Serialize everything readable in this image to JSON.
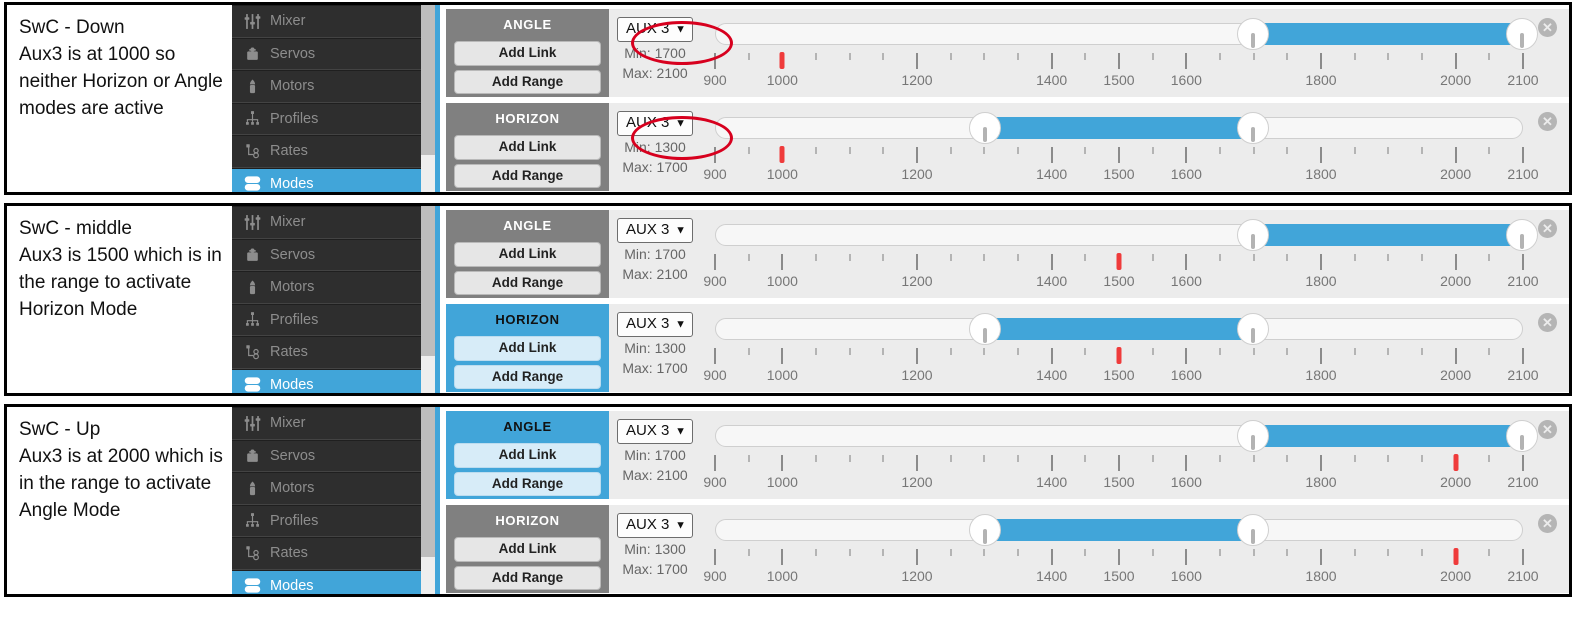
{
  "colors": {
    "accent": "#41a5d9",
    "mode_inactive": "#808080",
    "channel_marker": "#ef3b3b",
    "annotation": "#d7001e",
    "nav_bg": "#2e2e2e"
  },
  "sidebar": {
    "items": [
      {
        "label": "Mixer",
        "icon": "sliders-icon",
        "active": false
      },
      {
        "label": "Servos",
        "icon": "servo-icon",
        "active": false
      },
      {
        "label": "Motors",
        "icon": "motor-icon",
        "active": false
      },
      {
        "label": "Profiles",
        "icon": "profiles-icon",
        "active": false
      },
      {
        "label": "Rates",
        "icon": "rates-icon",
        "active": false
      },
      {
        "label": "Modes",
        "icon": "modes-icon",
        "active": true
      }
    ]
  },
  "scale": {
    "min": 900,
    "max": 2100,
    "major_ticks": [
      900,
      1000,
      1200,
      1400,
      1500,
      1600,
      1800,
      2000,
      2100
    ],
    "minor_ticks": [
      950,
      1050,
      1100,
      1150,
      1250,
      1300,
      1350,
      1450,
      1550,
      1650,
      1700,
      1750,
      1850,
      1900,
      1950,
      2050
    ]
  },
  "buttons": {
    "add_link": "Add Link",
    "add_range": "Add Range",
    "close": "✕"
  },
  "panels": [
    {
      "caption": "SwC - Down\nAux3 is at 1000 so neither Horizon or Angle modes are active",
      "channel_value": 1000,
      "annotated": true,
      "modes": [
        {
          "name": "ANGLE",
          "active": false,
          "channel": "AUX 3",
          "min_label": "Min: 1700",
          "max_label": "Max: 2100",
          "min": 1700,
          "max": 2100
        },
        {
          "name": "HORIZON",
          "active": false,
          "channel": "AUX 3",
          "min_label": "Min: 1300",
          "max_label": "Max: 1700",
          "min": 1300,
          "max": 1700
        }
      ]
    },
    {
      "caption": "SwC - middle\nAux3 is 1500 which is in the range to activate Horizon Mode",
      "channel_value": 1500,
      "annotated": false,
      "modes": [
        {
          "name": "ANGLE",
          "active": false,
          "channel": "AUX 3",
          "min_label": "Min: 1700",
          "max_label": "Max: 2100",
          "min": 1700,
          "max": 2100
        },
        {
          "name": "HORIZON",
          "active": true,
          "channel": "AUX 3",
          "min_label": "Min: 1300",
          "max_label": "Max: 1700",
          "min": 1300,
          "max": 1700
        }
      ]
    },
    {
      "caption": "SwC - Up\nAux3 is at 2000 which is in the range to activate Angle Mode",
      "channel_value": 2000,
      "annotated": false,
      "modes": [
        {
          "name": "ANGLE",
          "active": true,
          "channel": "AUX 3",
          "min_label": "Min: 1700",
          "max_label": "Max: 2100",
          "min": 1700,
          "max": 2100
        },
        {
          "name": "HORIZON",
          "active": false,
          "channel": "AUX 3",
          "min_label": "Min: 1300",
          "max_label": "Max: 1700",
          "min": 1300,
          "max": 1700
        }
      ]
    }
  ]
}
